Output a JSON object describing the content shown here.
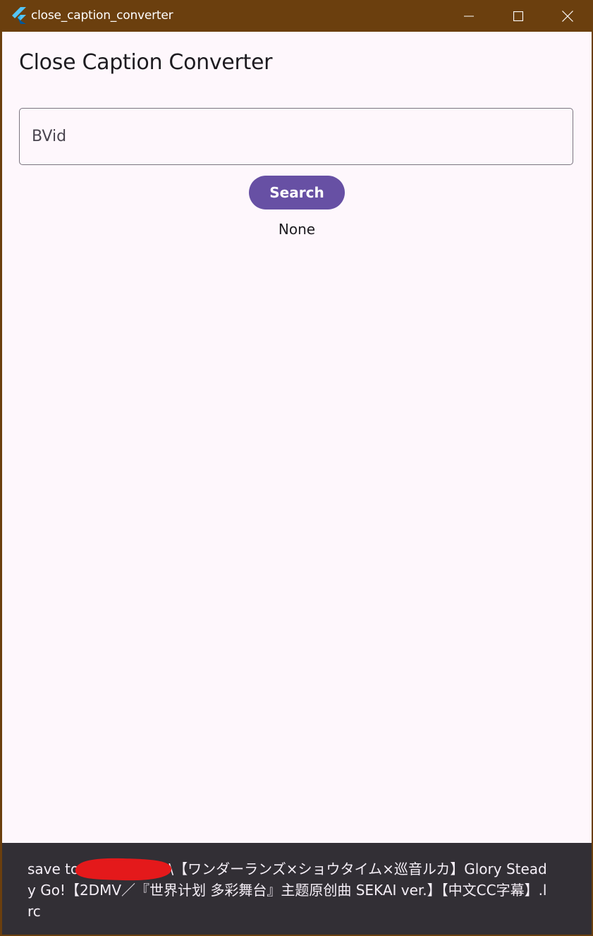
{
  "window": {
    "title": "close_caption_converter",
    "controls": {
      "minimize_icon": "minimize-icon",
      "maximize_icon": "maximize-icon",
      "close_icon": "close-icon"
    }
  },
  "main": {
    "heading": "Close Caption Converter",
    "bvid_input": {
      "placeholder": "BVid",
      "value": ""
    },
    "search_label": "Search",
    "result": "None"
  },
  "snackbar": {
    "message": "save to \\Documents\\【ワンダーランズ×ショウタイム×巡音ルカ】Glory Steady Go!【2DMV／『世界计划 多彩舞台』主题原创曲 SEKAI ver.】【中文CC字幕】.lrc"
  },
  "colors": {
    "titlebar": "#6b3f0e",
    "background": "#fef7fc",
    "primary": "#6750a4",
    "snackbar": "#322f35",
    "redaction": "#e4191b"
  }
}
